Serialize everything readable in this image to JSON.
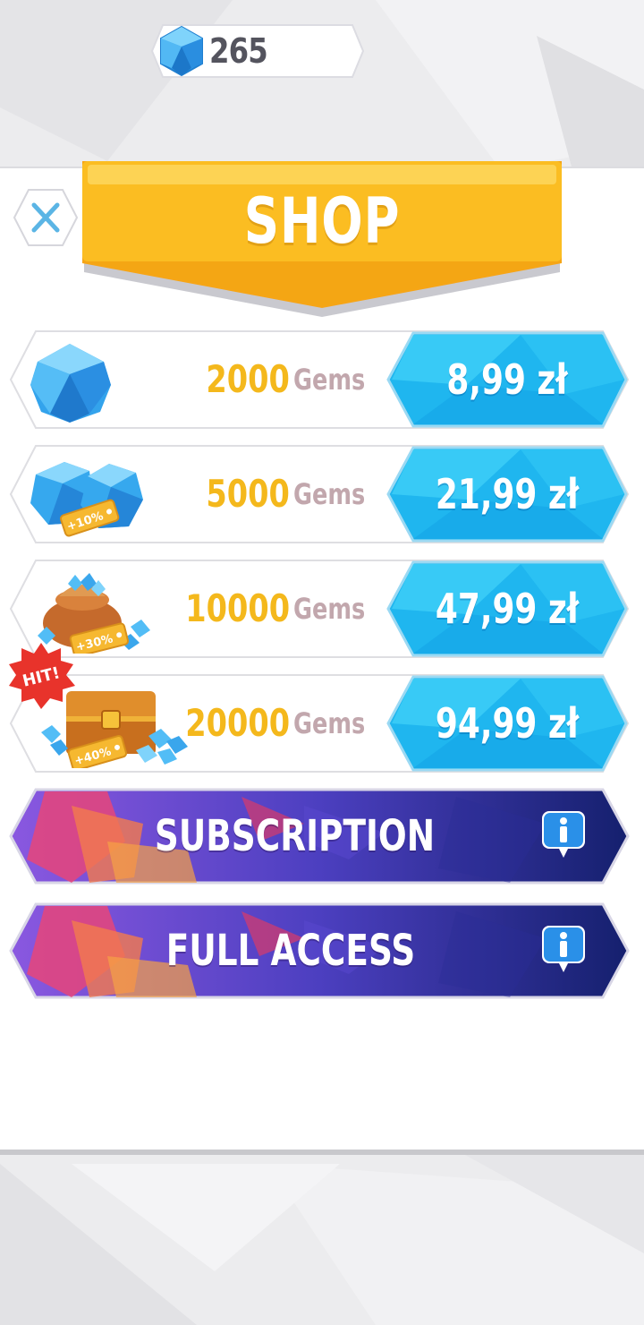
{
  "header": {
    "gem_balance": "265",
    "icons": {
      "balance": "gem-icon"
    }
  },
  "shop": {
    "title": "SHOP",
    "close_icon": "close-icon"
  },
  "offers": [
    {
      "amount": "2000",
      "unit": "Gems",
      "price": "8,99 zł",
      "icon": "single-gem-icon",
      "tag": ""
    },
    {
      "amount": "5000",
      "unit": "Gems",
      "price": "21,99 zł",
      "icon": "gem-pair-icon",
      "tag": "+10%"
    },
    {
      "amount": "10000",
      "unit": "Gems",
      "price": "47,99 zł",
      "icon": "gem-sack-icon",
      "tag": "+30%"
    },
    {
      "amount": "20000",
      "unit": "Gems",
      "price": "94,99 zł",
      "icon": "treasure-chest-icon",
      "tag": "+40%"
    }
  ],
  "hit_badge": "HIT!",
  "promos": [
    {
      "label": "SUBSCRIPTION",
      "icon": "info-icon"
    },
    {
      "label": "FULL ACCESS",
      "icon": "info-icon"
    }
  ],
  "colors": {
    "amount": "#f4b81c",
    "unit": "#c2a7ad",
    "price_button": "#27c6f2",
    "shop_banner": "#f7b521",
    "promo_gradient_start": "#7b4fd6",
    "promo_gradient_end": "#15206e",
    "hit_badge": "#e8332b"
  }
}
